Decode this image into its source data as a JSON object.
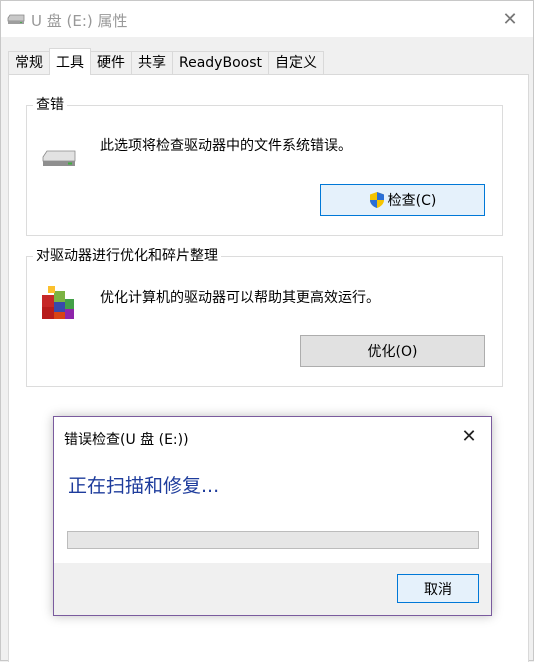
{
  "window": {
    "title": "U 盘 (E:) 属性",
    "close_glyph": "✕"
  },
  "tabs": [
    {
      "label": "常规",
      "active": false
    },
    {
      "label": "工具",
      "active": true
    },
    {
      "label": "硬件",
      "active": false
    },
    {
      "label": "共享",
      "active": false
    },
    {
      "label": "ReadyBoost",
      "active": false
    },
    {
      "label": "自定义",
      "active": false
    }
  ],
  "check_group": {
    "title": "查错",
    "description": "此选项将检查驱动器中的文件系统错误。",
    "button_label": "检查(C)",
    "icon": "drive-icon"
  },
  "optimize_group": {
    "title": "对驱动器进行优化和碎片整理",
    "description": "优化计算机的驱动器可以帮助其更高效运行。",
    "button_label": "优化(O)",
    "icon": "defrag-icon"
  },
  "dialog": {
    "title": "错误检查(U 盘 (E:))",
    "status": "正在扫描和修复...",
    "progress": 0,
    "cancel_label": "取消",
    "close_glyph": "✕"
  },
  "colors": {
    "status_text": "#1e3c9c",
    "focus_border": "#0078d7",
    "dialog_border": "#7a5b9e"
  }
}
